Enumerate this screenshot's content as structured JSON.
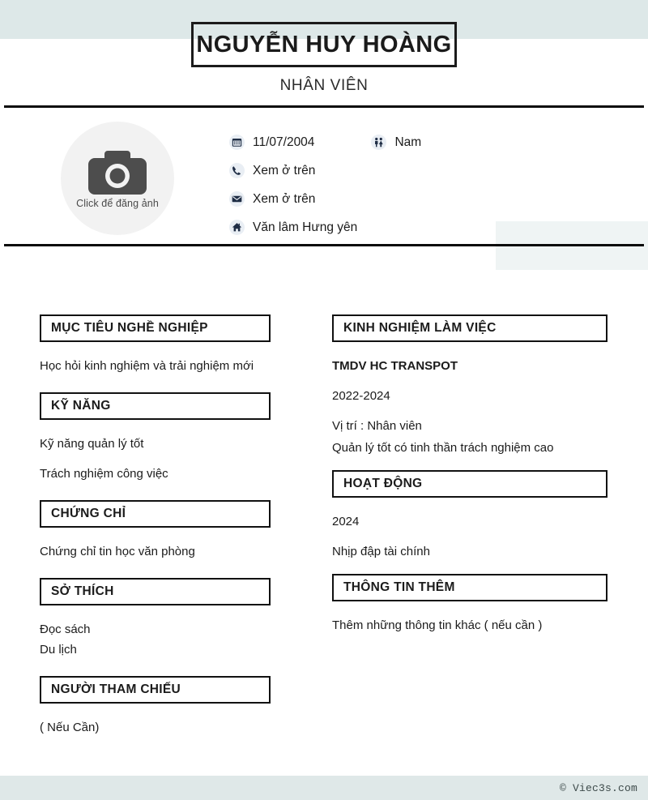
{
  "header": {
    "full_name": "NGUYỄN HUY HOÀNG",
    "job_title": "NHÂN VIÊN"
  },
  "photo": {
    "label": "Click để đăng ảnh",
    "icon": "camera-icon"
  },
  "contact": {
    "birthday": {
      "icon": "calendar-icon",
      "value": "11/07/2004"
    },
    "gender": {
      "icon": "gender-icon",
      "value": "Nam"
    },
    "phone": {
      "icon": "phone-icon",
      "value": "Xem ở trên"
    },
    "email": {
      "icon": "envelope-icon",
      "value": "Xem ở trên"
    },
    "address": {
      "icon": "home-icon",
      "value": "Văn lâm Hưng yên"
    }
  },
  "left_column": {
    "objective": {
      "heading": "MỤC TIÊU NGHỀ NGHIỆP",
      "text": "Học hỏi kinh nghiệm và trải nghiệm mới"
    },
    "skills": {
      "heading": "KỸ NĂNG",
      "items": [
        "Kỹ năng quản lý tốt",
        "Trách nghiệm công việc"
      ]
    },
    "certificates": {
      "heading": "CHỨNG CHỈ",
      "items": [
        "Chứng chỉ tin học văn phòng"
      ]
    },
    "hobbies": {
      "heading": "SỞ THÍCH",
      "items": [
        "Đọc sách",
        "Du lịch"
      ]
    },
    "references": {
      "heading": "NGƯỜI THAM CHIẾU",
      "items": [
        "( Nếu Cần)"
      ]
    }
  },
  "right_column": {
    "experience": {
      "heading": "KINH NGHIỆM LÀM VIỆC",
      "company": "TMDV HC TRANSPOT",
      "period": "2022-2024",
      "position": "Vị trí : Nhân viên",
      "description": "Quản lý tốt có tinh thần trách nghiệm cao"
    },
    "activities": {
      "heading": "HOẠT ĐỘNG",
      "period": "2024",
      "description": "Nhịp đập tài chính"
    },
    "additional": {
      "heading": "THÔNG TIN THÊM",
      "text": "Thêm những thông tin khác ( nếu cần )"
    }
  },
  "footer": {
    "copyright": "© Viec3s.com"
  },
  "colors": {
    "band": "#dde8e8",
    "panel": "#eff4f4",
    "footer_band": "#dfe8e8",
    "rule": "#0b0b0b",
    "icon_bg": "#e9eef4",
    "icon_fg": "#1f2d45"
  }
}
